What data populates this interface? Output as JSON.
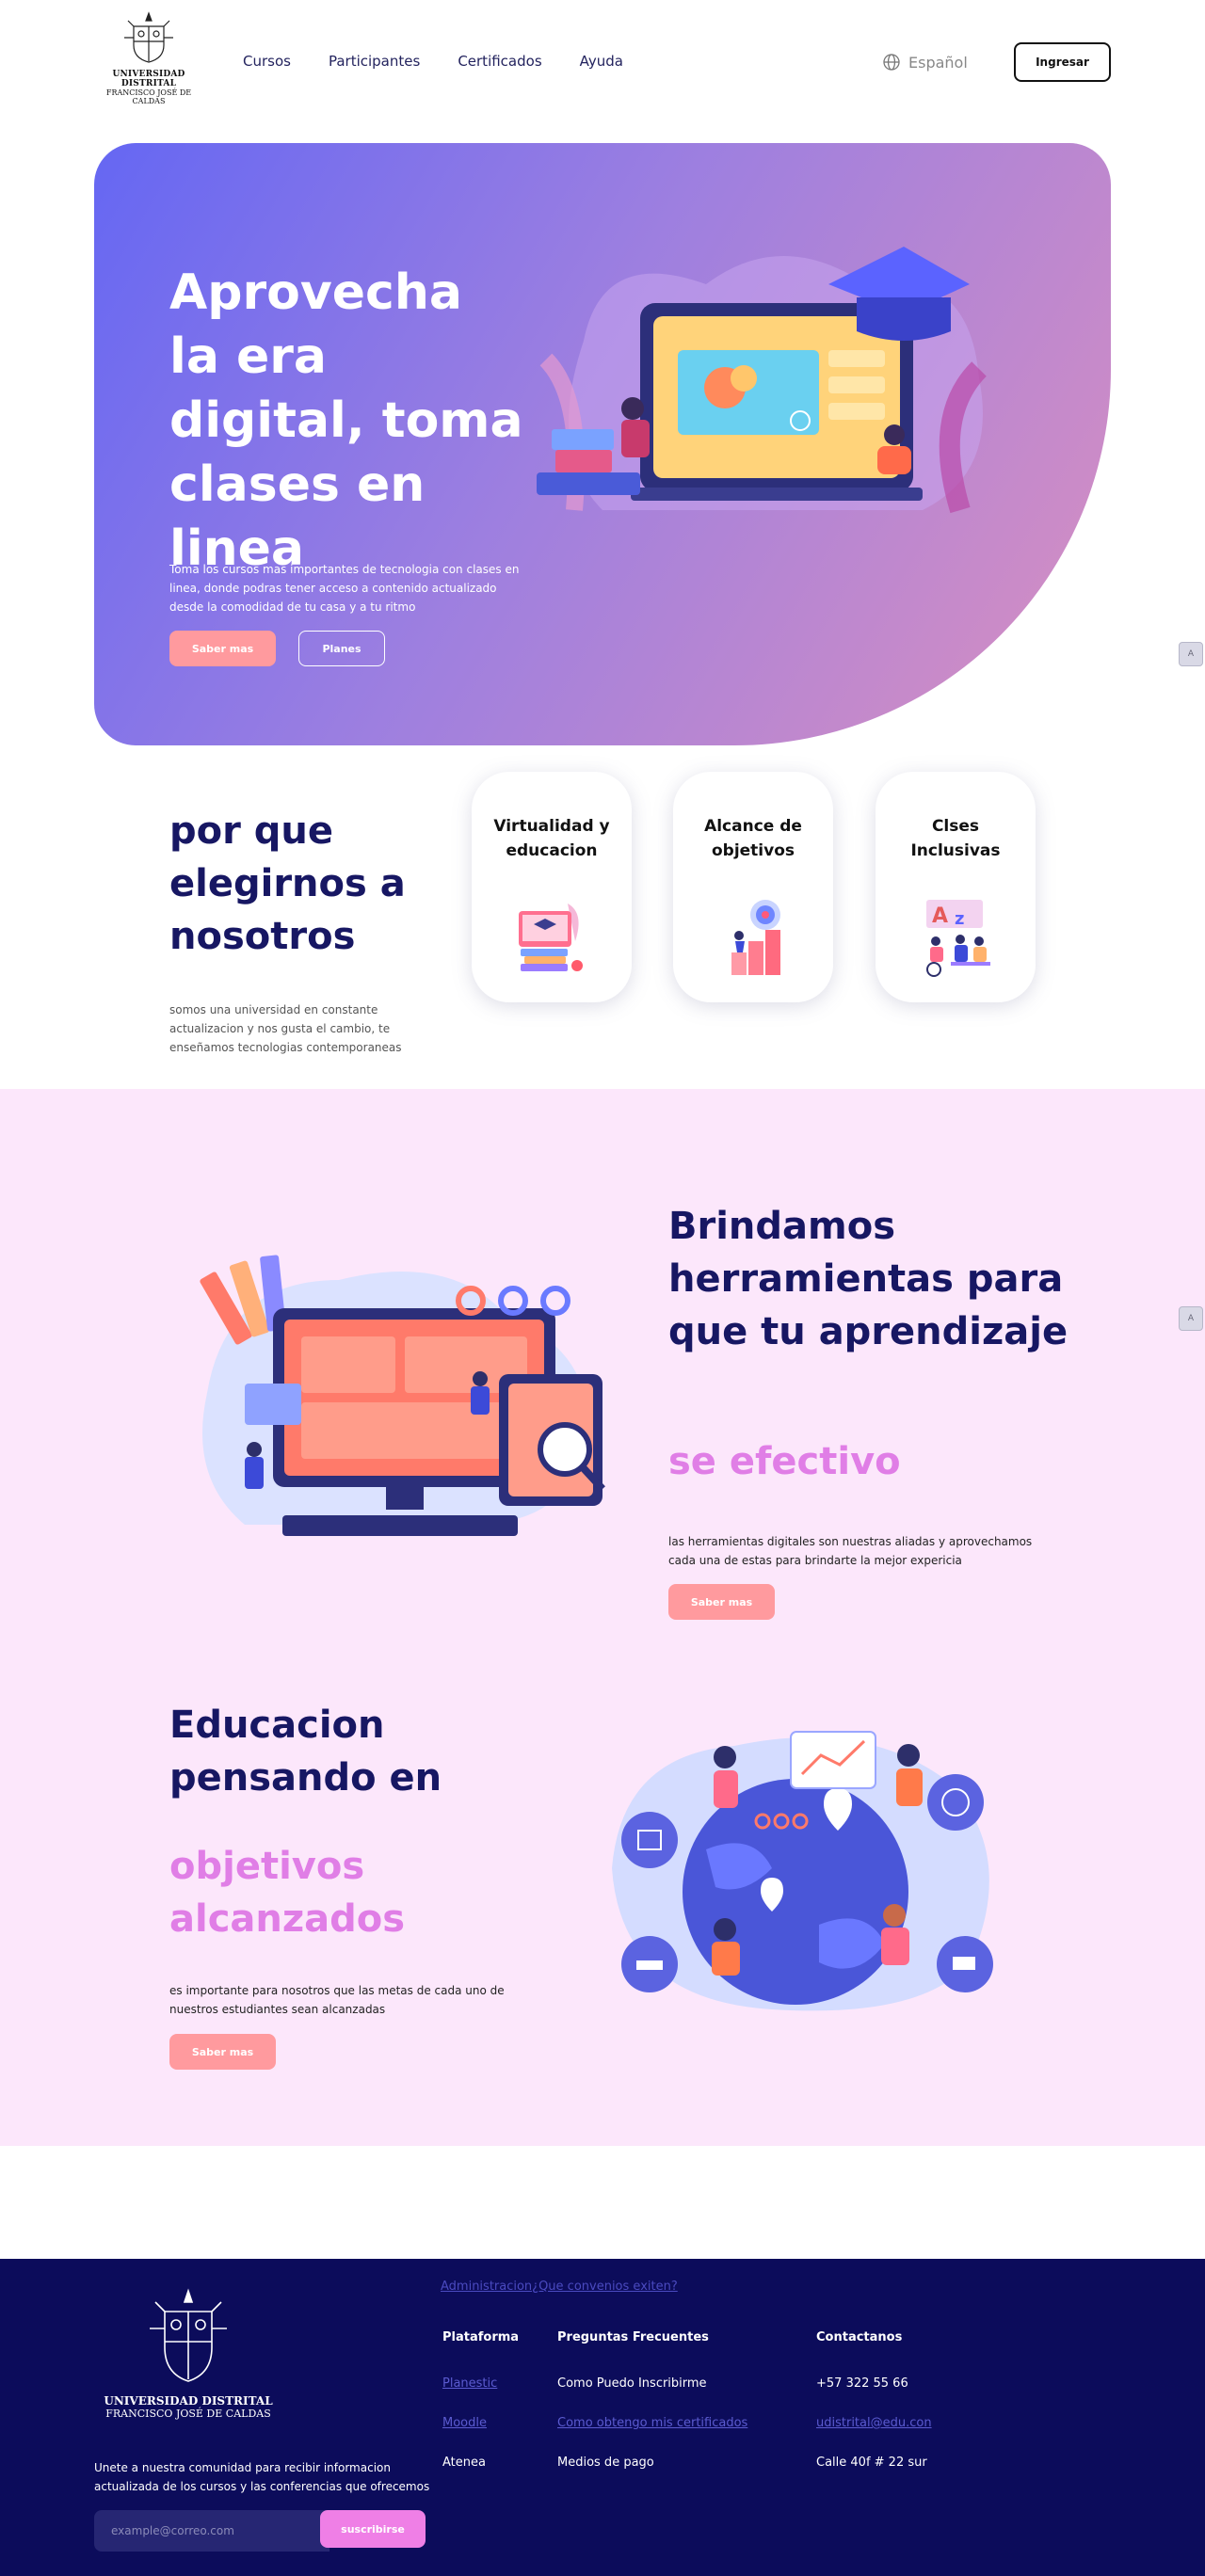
{
  "header": {
    "logo_line1": "UNIVERSIDAD DISTRITAL",
    "logo_line2": "FRANCISCO JOSÉ DE CALDAS",
    "nav": [
      "Cursos",
      "Participantes",
      "Certificados",
      "Ayuda"
    ],
    "language": "Español",
    "login": "Ingresar"
  },
  "hero": {
    "title": "Aprovecha la era digital, toma clases en linea",
    "description": "Toma los cursos mas importantes de tecnologia con clases en linea, donde podras tener acceso a contenido actualizado desde la comodidad de tu casa y a tu ritmo",
    "primary_button": "Saber mas",
    "secondary_button": "Planes"
  },
  "why": {
    "title": "por que elegirnos a nosotros",
    "description": "somos una universidad en constante actualizacion y nos gusta el cambio, te enseñamos tecnologias contemporaneas",
    "cards": [
      "Virtualidad y educacion",
      "Alcance de objetivos",
      "Clses Inclusivas"
    ]
  },
  "tools": {
    "title": "Brindamos herramientas para que tu aprendizaje",
    "subtitle": "se efectivo",
    "description": "las herramientas digitales son nuestras aliadas y aprovechamos cada una de estas para brindarte la mejor expericia",
    "button": "Saber mas"
  },
  "education": {
    "title": "Educacion pensando en",
    "subtitle": "objetivos alcanzados",
    "description": "es importante para nosotros que las metas de cada uno de nuestros estudiantes sean alcanzadas",
    "button": "Saber mas"
  },
  "footer": {
    "logo_line1": "UNIVERSIDAD DISTRITAL",
    "logo_line2": "FRANCISCO JOSÉ DE CALDAS",
    "join_text": "Unete a nuestra comunidad para recibir informacion actualizada de los cursos y las conferencias que ofrecemos",
    "email_placeholder": "example@correo.com",
    "subscribe": "suscribirse",
    "admin_link": "Administracion¿Que convenios exiten?",
    "platform": {
      "heading": "Plataforma",
      "items": [
        "Planestic",
        "Moodle",
        "Atenea"
      ]
    },
    "faq": {
      "heading": "Preguntas Frecuentes",
      "items": [
        "Como Puedo Inscribirme",
        "Como obtengo mis certificados",
        "Medios de pago"
      ]
    },
    "contact": {
      "heading": "Contactanos",
      "items": [
        "+57 322 55 66",
        "udistrital@edu.con",
        "Calle 40f # 22 sur"
      ]
    }
  },
  "colors": {
    "navy": "#171763",
    "pink_button": "#ff9a9e",
    "magenta": "#e07ee6",
    "footer_bg": "#0c0c5b",
    "section_bg": "#fce7fb"
  }
}
